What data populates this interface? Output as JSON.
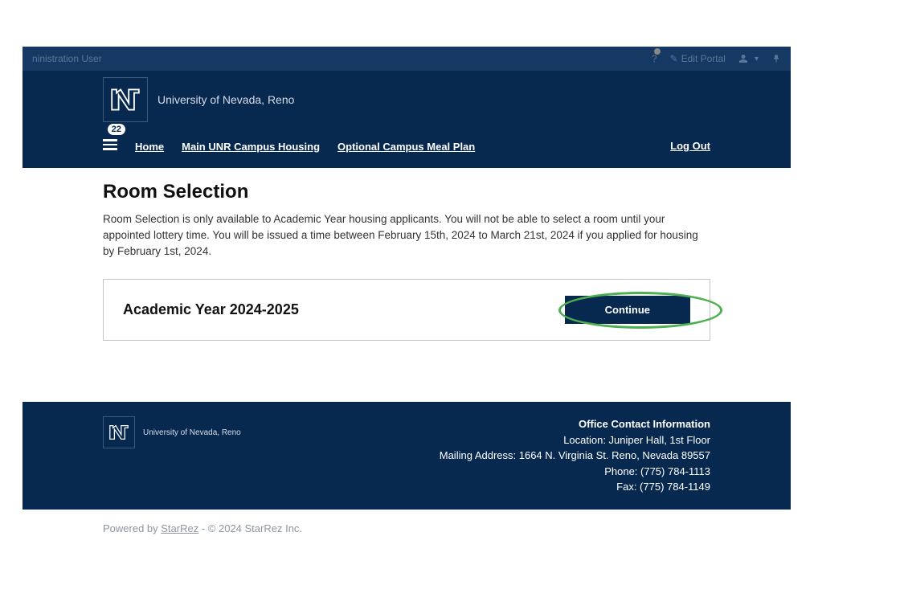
{
  "admin": {
    "userLabel": "ninistration User",
    "editPortal": "Edit Portal"
  },
  "header": {
    "university": "University of Nevada, Reno"
  },
  "nav": {
    "badge": "22",
    "home": "Home",
    "mainHousing": "Main UNR Campus Housing",
    "mealPlan": "Optional Campus Meal Plan",
    "logout": "Log Out"
  },
  "page": {
    "title": "Room Selection",
    "intro": "Room Selection is only available to Academic Year housing applicants. You will not be able to select a room until your appointed lottery time. You will be issued a time between February 15th, 2024 to March 21st, 2024 if you applied for housing by February 1st, 2024."
  },
  "card": {
    "title": "Academic Year 2024-2025",
    "continue": "Continue"
  },
  "footer": {
    "university": "University of Nevada, Reno",
    "heading": "Office Contact Information",
    "location": "Location: Juniper Hall, 1st Floor",
    "mailing": "Mailing Address: 1664 N. Virginia St. Reno, Nevada 89557",
    "phone": "Phone: (775) 784-1113",
    "fax": "Fax: (775) 784-1149"
  },
  "powered": {
    "prefix": "Powered by ",
    "link": "StarRez",
    "suffix": " - © 2024 StarRez Inc."
  }
}
